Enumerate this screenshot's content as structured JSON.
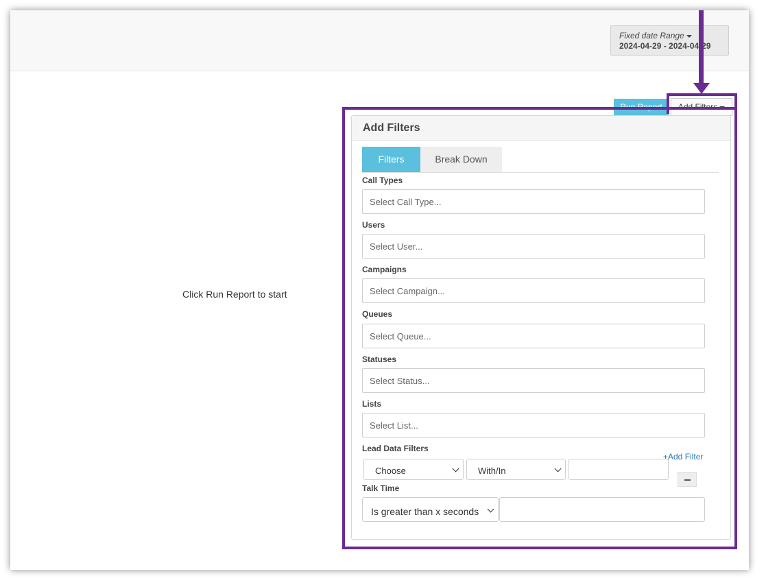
{
  "date_range": {
    "label": "Fixed date Range",
    "value": "2024-04-29 - 2024-04-29"
  },
  "main": {
    "hint": "Click Run Report to start"
  },
  "toolbar": {
    "run_report_label": "Run Report",
    "add_filters_label": "Add Filters"
  },
  "panel": {
    "title": "Add Filters",
    "tabs": [
      {
        "label": "Filters",
        "active": true
      },
      {
        "label": "Break Down",
        "active": false
      }
    ],
    "fields": [
      {
        "label": "Call Types",
        "placeholder": "Select Call Type..."
      },
      {
        "label": "Users",
        "placeholder": "Select User..."
      },
      {
        "label": "Campaigns",
        "placeholder": "Select Campaign..."
      },
      {
        "label": "Queues",
        "placeholder": "Select Queue..."
      },
      {
        "label": "Statuses",
        "placeholder": "Select Status..."
      },
      {
        "label": "Lists",
        "placeholder": "Select List..."
      }
    ],
    "lead_data": {
      "label": "Lead Data Filters",
      "add_link": "+Add Filter",
      "field_select": "Choose",
      "operator_select": "With/In",
      "value": ""
    },
    "talk_time": {
      "label": "Talk Time",
      "operator_select": "Is greater than x seconds",
      "value": ""
    }
  },
  "colors": {
    "accent": "#5bc0de",
    "annotation": "#6a2c91",
    "link": "#2a7ab0"
  }
}
